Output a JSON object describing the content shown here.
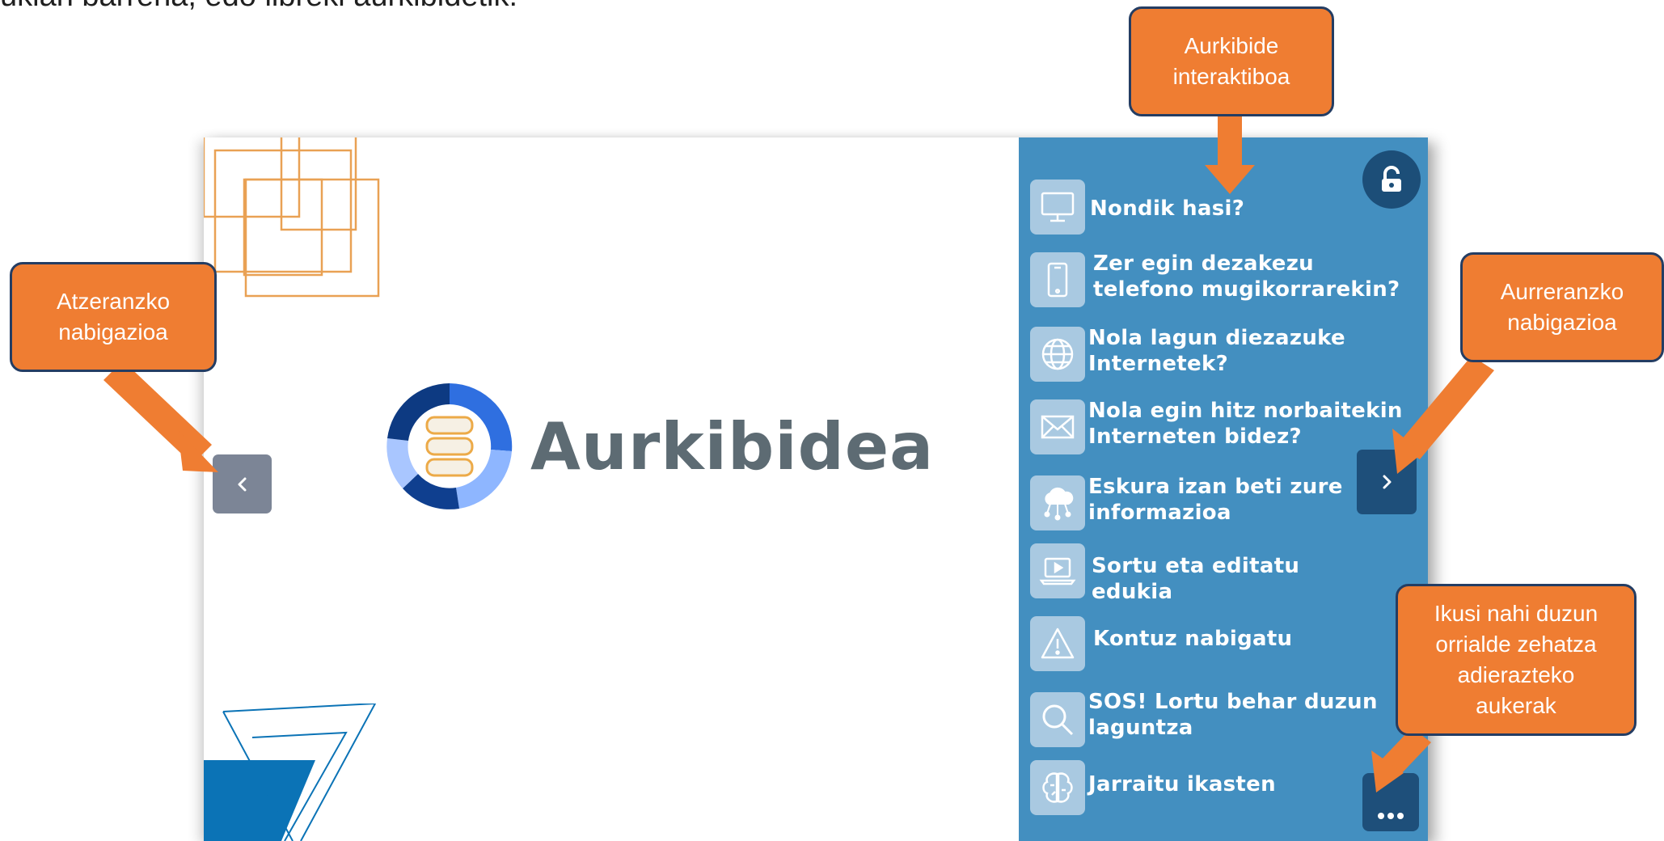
{
  "page": {
    "intro_text": "ukian barrena, edo libreki aurkibidetik:"
  },
  "slide": {
    "logo_text": "Aurkibidea",
    "prev_button": {
      "label": "‹",
      "icon": "chevron-left-icon"
    },
    "next_button": {
      "label": "›",
      "icon": "chevron-right-icon"
    },
    "more_button": {
      "label": "...",
      "icon": "more-dots-icon"
    },
    "lock_icon": "touch-unlock-icon"
  },
  "toc": {
    "items": [
      {
        "label": "Nondik hasi?",
        "icon": "monitor-icon"
      },
      {
        "label": "Zer egin dezakezu\ntelefono mugikorrarekin?",
        "icon": "smartphone-icon"
      },
      {
        "label": "Nola lagun diezazuke\nInternetek?",
        "icon": "globe-icon"
      },
      {
        "label": "Nola egin hitz norbaitekin\nInterneten bidez?",
        "icon": "envelope-icon"
      },
      {
        "label": "Eskura izan beti zure\ninformazioa",
        "icon": "cloud-network-icon"
      },
      {
        "label": "Sortu eta editatu\nedukia",
        "icon": "laptop-video-icon"
      },
      {
        "label": "Kontuz nabigatu",
        "icon": "warning-icon"
      },
      {
        "label": "SOS! Lortu behar duzun\nlaguntza",
        "icon": "magnifier-icon"
      },
      {
        "label": "Jarraitu ikasten",
        "icon": "brain-icon"
      }
    ]
  },
  "callouts": {
    "toc": "Aurkibide\ninteraktiboa",
    "back": "Atzeranzko\nnabigazioa",
    "forward": "Aurreranzko\nnabigazioa",
    "options": "Ikusi nahi duzun\norrialde zehatza\nadierazteko\naukerak"
  },
  "colors": {
    "callout_fill": "#ef7d32",
    "callout_border": "#243d63",
    "toc_panel": "#438fc0",
    "dark_button": "#1e4f7a",
    "prev_button": "#7c8596"
  }
}
